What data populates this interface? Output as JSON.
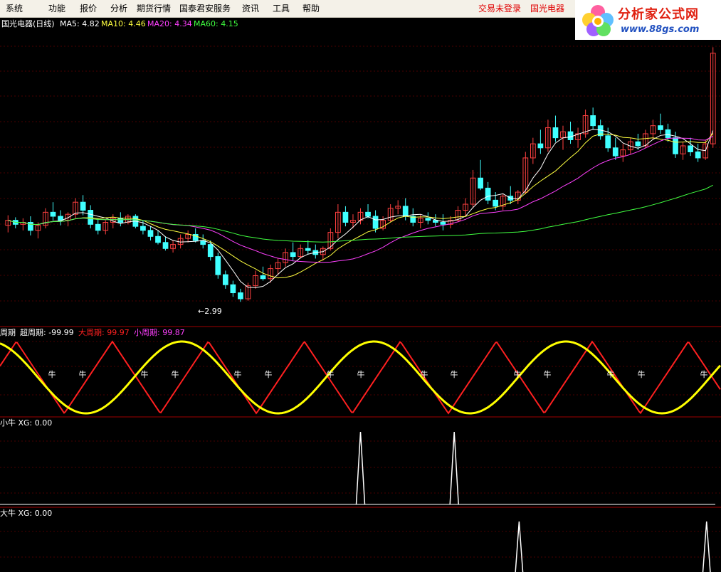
{
  "menu": {
    "items": [
      "系统",
      "功能",
      "报价",
      "分析",
      "期货行情",
      "国泰君安服务",
      "资讯",
      "工具",
      "帮助"
    ],
    "login_status": "交易未登录",
    "stock_name": "国光电器"
  },
  "logo": {
    "title": "分析家公式网",
    "url": "www.88gs.com"
  },
  "colors": {
    "background": "#000000",
    "up_candle": "#ff4040",
    "down_candle": "#40ffff",
    "ma5": "#ffffff",
    "ma10": "#ffff40",
    "ma20": "#ff40ff",
    "ma60": "#40ff40",
    "grid": "#4a0000",
    "cycle_red": "#ff2020",
    "cycle_yellow": "#ffff00",
    "signal": "#ffffff"
  },
  "price_panel": {
    "title": "国光电器(日线)",
    "ma5_label": "MA5: 4.82",
    "ma10_label": "MA10: 4.46",
    "ma20_label": "MA20: 4.34",
    "ma60_label": "MA60: 4.15",
    "low_label": "←2.99",
    "high_label": "5.52"
  },
  "cycle_panel": {
    "label_prefix": "周期",
    "super_label": "超周期: -99.99",
    "big_label": "大周期: 99.97",
    "small_label": "小周期: 99.87",
    "marker_text": "牛"
  },
  "small_bull_panel": {
    "label": "小牛  XG: 0.00"
  },
  "big_bull_panel": {
    "label": "大牛  XG: 0.00"
  },
  "chart_data": {
    "type": "candlestick",
    "series": [
      {
        "name": "国光电器",
        "values": [
          [
            3.75,
            3.85,
            3.68,
            3.8
          ],
          [
            3.8,
            3.83,
            3.72,
            3.76
          ],
          [
            3.76,
            3.82,
            3.7,
            3.78
          ],
          [
            3.78,
            3.84,
            3.65,
            3.7
          ],
          [
            3.7,
            3.78,
            3.62,
            3.75
          ],
          [
            3.75,
            3.92,
            3.72,
            3.88
          ],
          [
            3.88,
            3.98,
            3.8,
            3.84
          ],
          [
            3.84,
            3.9,
            3.75,
            3.8
          ],
          [
            3.8,
            3.88,
            3.74,
            3.86
          ],
          [
            3.86,
            4.02,
            3.82,
            3.98
          ],
          [
            3.98,
            4.05,
            3.85,
            3.9
          ],
          [
            3.9,
            3.95,
            3.72,
            3.76
          ],
          [
            3.76,
            3.82,
            3.66,
            3.7
          ],
          [
            3.7,
            3.8,
            3.66,
            3.78
          ],
          [
            3.78,
            3.86,
            3.72,
            3.82
          ],
          [
            3.82,
            3.88,
            3.74,
            3.78
          ],
          [
            3.78,
            3.86,
            3.76,
            3.84
          ],
          [
            3.84,
            3.86,
            3.72,
            3.74
          ],
          [
            3.74,
            3.8,
            3.66,
            3.7
          ],
          [
            3.7,
            3.74,
            3.6,
            3.64
          ],
          [
            3.64,
            3.7,
            3.56,
            3.58
          ],
          [
            3.58,
            3.64,
            3.5,
            3.52
          ],
          [
            3.52,
            3.6,
            3.48,
            3.56
          ],
          [
            3.56,
            3.66,
            3.52,
            3.62
          ],
          [
            3.62,
            3.7,
            3.58,
            3.66
          ],
          [
            3.66,
            3.72,
            3.58,
            3.6
          ],
          [
            3.6,
            3.66,
            3.52,
            3.56
          ],
          [
            3.56,
            3.6,
            3.4,
            3.44
          ],
          [
            3.44,
            3.48,
            3.22,
            3.26
          ],
          [
            3.26,
            3.3,
            3.12,
            3.16
          ],
          [
            3.16,
            3.2,
            3.04,
            3.08
          ],
          [
            3.08,
            3.12,
            2.99,
            3.02
          ],
          [
            3.02,
            3.18,
            3.0,
            3.15
          ],
          [
            3.15,
            3.3,
            3.12,
            3.25
          ],
          [
            3.25,
            3.34,
            3.2,
            3.22
          ],
          [
            3.22,
            3.36,
            3.18,
            3.32
          ],
          [
            3.32,
            3.42,
            3.26,
            3.38
          ],
          [
            3.38,
            3.52,
            3.34,
            3.48
          ],
          [
            3.48,
            3.58,
            3.4,
            3.44
          ],
          [
            3.44,
            3.56,
            3.42,
            3.52
          ],
          [
            3.52,
            3.6,
            3.46,
            3.5
          ],
          [
            3.5,
            3.56,
            3.42,
            3.46
          ],
          [
            3.46,
            3.54,
            3.4,
            3.52
          ],
          [
            3.52,
            3.72,
            3.5,
            3.68
          ],
          [
            3.68,
            3.96,
            3.62,
            3.88
          ],
          [
            3.88,
            3.94,
            3.74,
            3.78
          ],
          [
            3.78,
            3.86,
            3.72,
            3.8
          ],
          [
            3.8,
            3.92,
            3.76,
            3.88
          ],
          [
            3.88,
            3.96,
            3.82,
            3.84
          ],
          [
            3.84,
            3.9,
            3.68,
            3.72
          ],
          [
            3.72,
            3.84,
            3.7,
            3.8
          ],
          [
            3.8,
            3.96,
            3.78,
            3.92
          ],
          [
            3.92,
            4.0,
            3.86,
            3.94
          ],
          [
            3.94,
            4.02,
            3.8,
            3.84
          ],
          [
            3.84,
            3.92,
            3.74,
            3.78
          ],
          [
            3.78,
            3.86,
            3.72,
            3.82
          ],
          [
            3.82,
            3.88,
            3.76,
            3.8
          ],
          [
            3.8,
            3.86,
            3.74,
            3.78
          ],
          [
            3.78,
            3.86,
            3.7,
            3.76
          ],
          [
            3.76,
            3.84,
            3.72,
            3.8
          ],
          [
            3.8,
            3.94,
            3.78,
            3.9
          ],
          [
            3.9,
            4.02,
            3.84,
            3.96
          ],
          [
            3.96,
            4.3,
            3.92,
            4.22
          ],
          [
            4.22,
            4.4,
            4.1,
            4.12
          ],
          [
            4.12,
            4.18,
            3.96,
            4.0
          ],
          [
            4.0,
            4.08,
            3.9,
            3.94
          ],
          [
            3.94,
            4.06,
            3.9,
            4.04
          ],
          [
            4.04,
            4.14,
            3.96,
            4.0
          ],
          [
            4.0,
            4.1,
            3.96,
            4.08
          ],
          [
            4.08,
            4.48,
            4.06,
            4.42
          ],
          [
            4.42,
            4.62,
            4.36,
            4.56
          ],
          [
            4.56,
            4.7,
            4.46,
            4.52
          ],
          [
            4.52,
            4.8,
            4.48,
            4.72
          ],
          [
            4.72,
            4.84,
            4.58,
            4.62
          ],
          [
            4.62,
            4.74,
            4.5,
            4.68
          ],
          [
            4.68,
            4.78,
            4.56,
            4.6
          ],
          [
            4.6,
            4.72,
            4.52,
            4.66
          ],
          [
            4.66,
            4.9,
            4.62,
            4.84
          ],
          [
            4.84,
            4.92,
            4.7,
            4.74
          ],
          [
            4.74,
            4.8,
            4.6,
            4.64
          ],
          [
            4.64,
            4.72,
            4.48,
            4.52
          ],
          [
            4.52,
            4.62,
            4.4,
            4.44
          ],
          [
            4.44,
            4.56,
            4.38,
            4.5
          ],
          [
            4.5,
            4.62,
            4.46,
            4.58
          ],
          [
            4.58,
            4.66,
            4.5,
            4.54
          ],
          [
            4.54,
            4.7,
            4.52,
            4.66
          ],
          [
            4.66,
            4.8,
            4.6,
            4.74
          ],
          [
            4.74,
            4.86,
            4.66,
            4.7
          ],
          [
            4.7,
            4.76,
            4.58,
            4.62
          ],
          [
            4.62,
            4.68,
            4.42,
            4.46
          ],
          [
            4.46,
            4.58,
            4.4,
            4.54
          ],
          [
            4.54,
            4.62,
            4.44,
            4.48
          ],
          [
            4.48,
            4.56,
            4.38,
            4.42
          ],
          [
            4.42,
            4.6,
            4.4,
            4.56
          ],
          [
            4.56,
            5.52,
            4.52,
            5.46
          ]
        ]
      }
    ],
    "ohlc_order": [
      "open",
      "high",
      "low",
      "close"
    ],
    "price_range": [
      2.9,
      5.6
    ],
    "cycle_red_period": 12.8,
    "cycle_yellow_period": 25.6,
    "small_bull_signals": [
      0.5,
      0.63
    ],
    "big_bull_signals": [
      0.72,
      0.98
    ],
    "x_axis": "none",
    "y_axis": "none",
    "grid": true
  }
}
